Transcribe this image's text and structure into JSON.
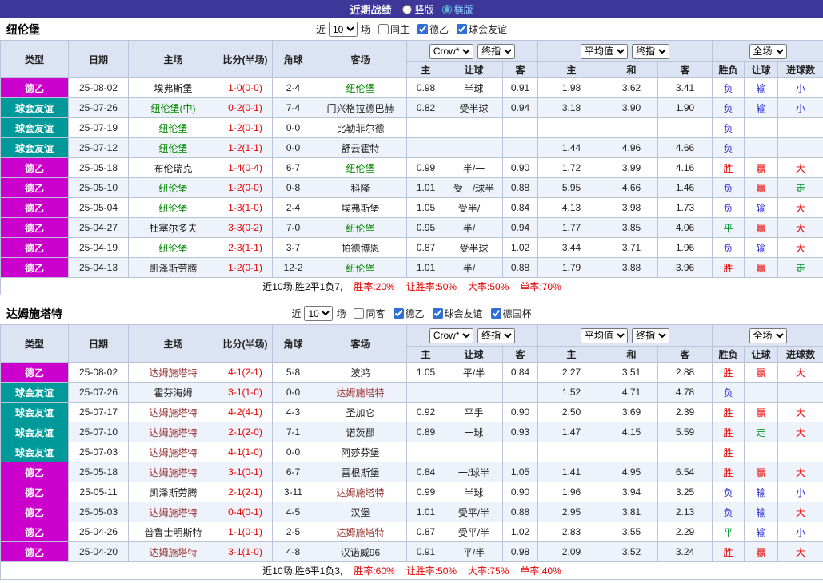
{
  "topbar": {
    "title": "近期战绩",
    "vertical_label": "竖版",
    "horizontal_label": "横版",
    "selected": "横版"
  },
  "table_headers": [
    "类型",
    "日期",
    "主场",
    "比分(半场)",
    "角球",
    "客场"
  ],
  "sub_headers": [
    "主",
    "让球",
    "客",
    "主",
    "和",
    "客",
    "胜负",
    "让球",
    "进球数"
  ],
  "selectors": {
    "company": "Crow*",
    "company_time": "终指",
    "average": "平均值",
    "average_time": "终指",
    "scope": "全场"
  },
  "styles": {
    "type_colors": {
      "德乙": "#cc00cc",
      "球会友谊": "#009999"
    },
    "result_colors": {
      "胜": "#e60000",
      "平": "#009933",
      "负": "#2b2bcc",
      "赢": "#e60000",
      "输": "#2b2bcc",
      "走": "#009933",
      "大": "#e60000",
      "小": "#2b2bcc"
    }
  },
  "sections": [
    {
      "team": "纽伦堡",
      "focus_color": "#008800",
      "filter": {
        "prefix": "近",
        "count": "10",
        "suffix": "场",
        "options": [
          {
            "label": "同主",
            "checked": false
          },
          {
            "label": "德乙",
            "checked": true
          },
          {
            "label": "球会友谊",
            "checked": true
          }
        ]
      },
      "rows": [
        {
          "type": "德乙",
          "date": "25-08-02",
          "home": "埃弗斯堡",
          "home_focus": false,
          "score": "1-0(0-0)",
          "corners": "2-4",
          "away": "纽伦堡",
          "away_focus": true,
          "odds": [
            "0.98",
            "半球",
            "0.91",
            "1.98",
            "3.62",
            "3.41"
          ],
          "results": [
            "负",
            "输",
            "小"
          ]
        },
        {
          "type": "球会友谊",
          "date": "25-07-26",
          "home": "纽伦堡(中)",
          "home_focus": true,
          "score": "0-2(0-1)",
          "corners": "7-4",
          "away": "门兴格拉德巴赫",
          "away_focus": false,
          "odds": [
            "0.82",
            "受半球",
            "0.94",
            "3.18",
            "3.90",
            "1.90"
          ],
          "results": [
            "负",
            "输",
            "小"
          ]
        },
        {
          "type": "球会友谊",
          "date": "25-07-19",
          "home": "纽伦堡",
          "home_focus": true,
          "score": "1-2(0-1)",
          "corners": "0-0",
          "away": "比勒菲尔德",
          "away_focus": false,
          "odds": [
            "",
            "",
            "",
            "",
            "",
            ""
          ],
          "results": [
            "负",
            "",
            ""
          ]
        },
        {
          "type": "球会友谊",
          "date": "25-07-12",
          "home": "纽伦堡",
          "home_focus": true,
          "score": "1-2(1-1)",
          "corners": "0-0",
          "away": "舒云霍特",
          "away_focus": false,
          "odds": [
            "",
            "",
            "",
            "1.44",
            "4.96",
            "4.66"
          ],
          "results": [
            "负",
            "",
            ""
          ]
        },
        {
          "type": "德乙",
          "date": "25-05-18",
          "home": "布伦瑞克",
          "home_focus": false,
          "score": "1-4(0-4)",
          "corners": "6-7",
          "away": "纽伦堡",
          "away_focus": true,
          "odds": [
            "0.99",
            "半/一",
            "0.90",
            "1.72",
            "3.99",
            "4.16"
          ],
          "results": [
            "胜",
            "赢",
            "大"
          ]
        },
        {
          "type": "德乙",
          "date": "25-05-10",
          "home": "纽伦堡",
          "home_focus": true,
          "score": "1-2(0-0)",
          "corners": "0-8",
          "away": "科隆",
          "away_focus": false,
          "odds": [
            "1.01",
            "受一/球半",
            "0.88",
            "5.95",
            "4.66",
            "1.46"
          ],
          "results": [
            "负",
            "赢",
            "走"
          ]
        },
        {
          "type": "德乙",
          "date": "25-05-04",
          "home": "纽伦堡",
          "home_focus": true,
          "score": "1-3(1-0)",
          "corners": "2-4",
          "away": "埃弗斯堡",
          "away_focus": false,
          "odds": [
            "1.05",
            "受半/一",
            "0.84",
            "4.13",
            "3.98",
            "1.73"
          ],
          "results": [
            "负",
            "输",
            "大"
          ]
        },
        {
          "type": "德乙",
          "date": "25-04-27",
          "home": "杜塞尔多夫",
          "home_focus": false,
          "score": "3-3(0-2)",
          "corners": "7-0",
          "away": "纽伦堡",
          "away_focus": true,
          "odds": [
            "0.95",
            "半/一",
            "0.94",
            "1.77",
            "3.85",
            "4.06"
          ],
          "results": [
            "平",
            "赢",
            "大"
          ]
        },
        {
          "type": "德乙",
          "date": "25-04-19",
          "home": "纽伦堡",
          "home_focus": true,
          "score": "2-3(1-1)",
          "corners": "3-7",
          "away": "帕德博恩",
          "away_focus": false,
          "odds": [
            "0.87",
            "受半球",
            "1.02",
            "3.44",
            "3.71",
            "1.96"
          ],
          "results": [
            "负",
            "输",
            "大"
          ]
        },
        {
          "type": "德乙",
          "date": "25-04-13",
          "home": "凯泽斯劳腾",
          "home_focus": false,
          "score": "1-2(0-1)",
          "corners": "12-2",
          "away": "纽伦堡",
          "away_focus": true,
          "odds": [
            "1.01",
            "半/一",
            "0.88",
            "1.79",
            "3.88",
            "3.96"
          ],
          "results": [
            "胜",
            "赢",
            "走"
          ]
        }
      ],
      "summary": {
        "record": "近10场,胜2平1负7,",
        "stats": [
          "胜率:20%",
          "让胜率:50%",
          "大率:50%",
          "单率:70%"
        ]
      }
    },
    {
      "team": "达姆施塔特",
      "focus_color": "#993333",
      "filter": {
        "prefix": "近",
        "count": "10",
        "suffix": "场",
        "options": [
          {
            "label": "同客",
            "checked": false
          },
          {
            "label": "德乙",
            "checked": true
          },
          {
            "label": "球会友谊",
            "checked": true
          },
          {
            "label": "德国杯",
            "checked": true
          }
        ]
      },
      "rows": [
        {
          "type": "德乙",
          "date": "25-08-02",
          "home": "达姆施塔特",
          "home_focus": true,
          "score": "4-1(2-1)",
          "corners": "5-8",
          "away": "波鸿",
          "away_focus": false,
          "odds": [
            "1.05",
            "平/半",
            "0.84",
            "2.27",
            "3.51",
            "2.88"
          ],
          "results": [
            "胜",
            "赢",
            "大"
          ]
        },
        {
          "type": "球会友谊",
          "date": "25-07-26",
          "home": "霍芬海姆",
          "home_focus": false,
          "score": "3-1(1-0)",
          "corners": "0-0",
          "away": "达姆施塔特",
          "away_focus": true,
          "odds": [
            "",
            "",
            "",
            "1.52",
            "4.71",
            "4.78"
          ],
          "results": [
            "负",
            "",
            ""
          ]
        },
        {
          "type": "球会友谊",
          "date": "25-07-17",
          "home": "达姆施塔特",
          "home_focus": true,
          "score": "4-2(4-1)",
          "corners": "4-3",
          "away": "圣加仑",
          "away_focus": false,
          "odds": [
            "0.92",
            "平手",
            "0.90",
            "2.50",
            "3.69",
            "2.39"
          ],
          "results": [
            "胜",
            "赢",
            "大"
          ]
        },
        {
          "type": "球会友谊",
          "date": "25-07-10",
          "home": "达姆施塔特",
          "home_focus": true,
          "score": "2-1(2-0)",
          "corners": "7-1",
          "away": "诺茨郡",
          "away_focus": false,
          "odds": [
            "0.89",
            "一球",
            "0.93",
            "1.47",
            "4.15",
            "5.59"
          ],
          "results": [
            "胜",
            "走",
            "大"
          ]
        },
        {
          "type": "球会友谊",
          "date": "25-07-03",
          "home": "达姆施塔特",
          "home_focus": true,
          "score": "4-1(1-0)",
          "corners": "0-0",
          "away": "阿莎芬堡",
          "away_focus": false,
          "odds": [
            "",
            "",
            "",
            "",
            "",
            ""
          ],
          "results": [
            "胜",
            "",
            ""
          ]
        },
        {
          "type": "德乙",
          "date": "25-05-18",
          "home": "达姆施塔特",
          "home_focus": true,
          "score": "3-1(0-1)",
          "corners": "6-7",
          "away": "雷根斯堡",
          "away_focus": false,
          "odds": [
            "0.84",
            "一/球半",
            "1.05",
            "1.41",
            "4.95",
            "6.54"
          ],
          "results": [
            "胜",
            "赢",
            "大"
          ]
        },
        {
          "type": "德乙",
          "date": "25-05-11",
          "home": "凯泽斯劳腾",
          "home_focus": false,
          "score": "2-1(2-1)",
          "corners": "3-11",
          "away": "达姆施塔特",
          "away_focus": true,
          "odds": [
            "0.99",
            "半球",
            "0.90",
            "1.96",
            "3.94",
            "3.25"
          ],
          "results": [
            "负",
            "输",
            "小"
          ]
        },
        {
          "type": "德乙",
          "date": "25-05-03",
          "home": "达姆施塔特",
          "home_focus": true,
          "score": "0-4(0-1)",
          "corners": "4-5",
          "away": "汉堡",
          "away_focus": false,
          "odds": [
            "1.01",
            "受平/半",
            "0.88",
            "2.95",
            "3.81",
            "2.13"
          ],
          "results": [
            "负",
            "输",
            "大"
          ]
        },
        {
          "type": "德乙",
          "date": "25-04-26",
          "home": "普鲁士明斯特",
          "home_focus": false,
          "score": "1-1(0-1)",
          "corners": "2-5",
          "away": "达姆施塔特",
          "away_focus": true,
          "odds": [
            "0.87",
            "受平/半",
            "1.02",
            "2.83",
            "3.55",
            "2.29"
          ],
          "results": [
            "平",
            "输",
            "小"
          ]
        },
        {
          "type": "德乙",
          "date": "25-04-20",
          "home": "达姆施塔特",
          "home_focus": true,
          "score": "3-1(1-0)",
          "corners": "4-8",
          "away": "汉诺威96",
          "away_focus": false,
          "odds": [
            "0.91",
            "平/半",
            "0.98",
            "2.09",
            "3.52",
            "3.24"
          ],
          "results": [
            "胜",
            "赢",
            "大"
          ]
        }
      ],
      "summary": {
        "record": "近10场,胜6平1负3,",
        "stats": [
          "胜率:60%",
          "让胜率:50%",
          "大率:75%",
          "单率:40%"
        ]
      }
    }
  ]
}
